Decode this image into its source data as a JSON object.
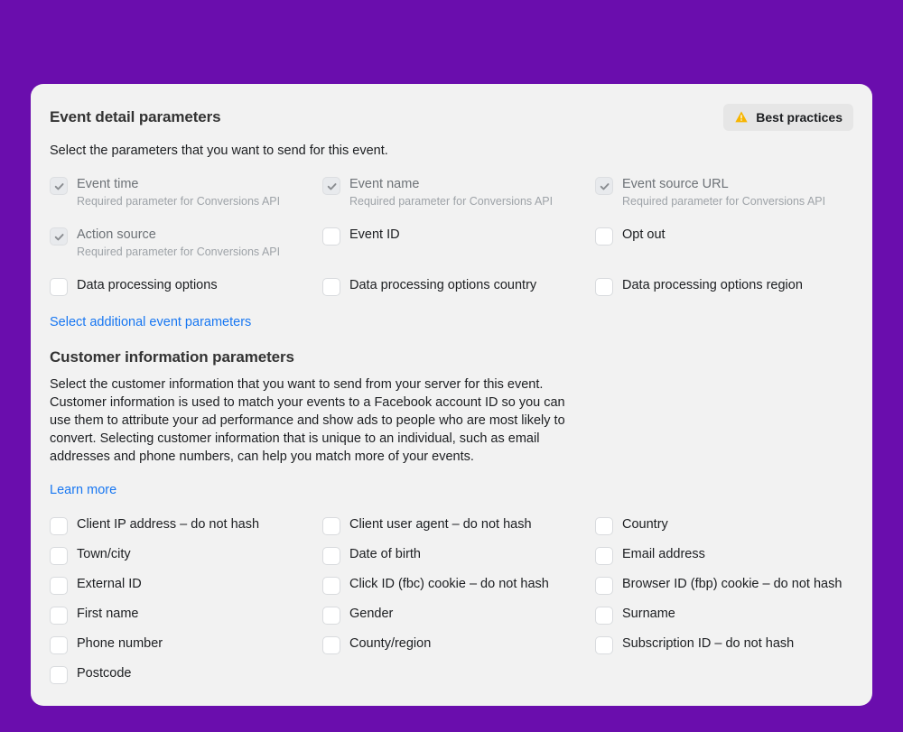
{
  "header": {
    "title": "Event detail parameters",
    "best_practices": "Best practices"
  },
  "event_section": {
    "desc": "Select the parameters that you want to send for this event.",
    "required_sub": "Required parameter for Conversions API",
    "params": {
      "event_time": "Event time",
      "event_name": "Event name",
      "event_source_url": "Event source URL",
      "action_source": "Action source",
      "event_id": "Event ID",
      "opt_out": "Opt out",
      "dpo": "Data processing options",
      "dpo_country": "Data processing options country",
      "dpo_region": "Data processing options region"
    },
    "additional_link": "Select additional event parameters"
  },
  "customer_section": {
    "title": "Customer information parameters",
    "desc": "Select the customer information that you want to send from your server for this event. Customer information is used to match your events to a Facebook account ID so you can use them to attribute your ad performance and show ads to people who are most likely to convert. Selecting customer information that is unique to an individual, such as email addresses and phone numbers, can help you match more of your events.",
    "learn_more": "Learn more",
    "params": {
      "client_ip": "Client IP address – do not hash",
      "client_ua": "Client user agent – do not hash",
      "country": "Country",
      "town": "Town/city",
      "dob": "Date of birth",
      "email": "Email address",
      "external_id": "External ID",
      "fbc": "Click ID (fbc) cookie – do not hash",
      "fbp": "Browser ID (fbp) cookie – do not hash",
      "first_name": "First name",
      "gender": "Gender",
      "surname": "Surname",
      "phone": "Phone number",
      "county": "County/region",
      "sub_id": "Subscription ID – do not hash",
      "postcode": "Postcode"
    }
  }
}
